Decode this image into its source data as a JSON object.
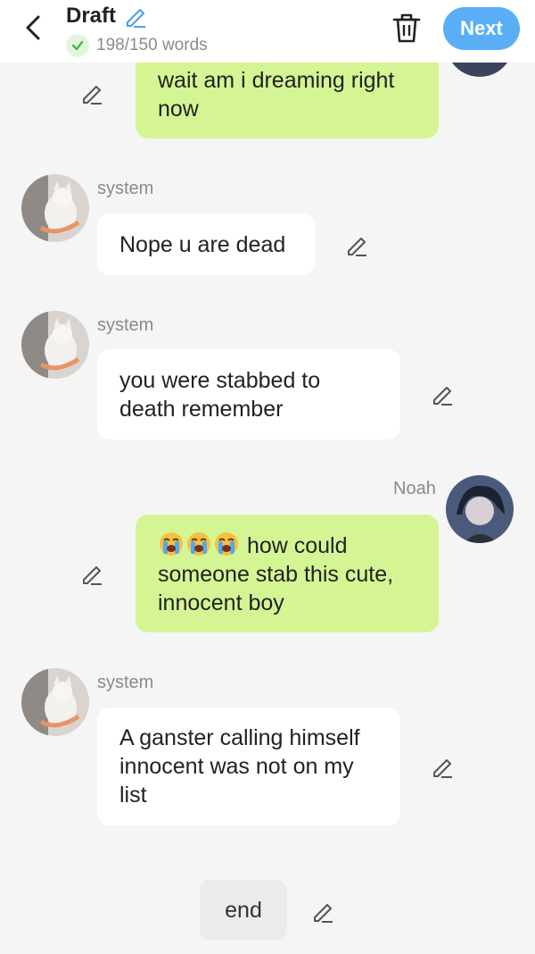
{
  "header": {
    "title": "Draft",
    "word_count": "198/150 words",
    "next_label": "Next"
  },
  "messages": [
    {
      "role": "user",
      "text": "wait am i dreaming right now"
    },
    {
      "role": "system",
      "sender": "system",
      "text": "Nope u are dead"
    },
    {
      "role": "system",
      "sender": "system",
      "text": "you were stabbed to death remember"
    },
    {
      "role": "user",
      "sender": "Noah",
      "emoji": [
        "loudly-crying-face",
        "loudly-crying-face",
        "loudly-crying-face"
      ],
      "text": " how could someone stab this cute, innocent boy"
    },
    {
      "role": "system",
      "sender": "system",
      "text": "A ganster calling himself innocent was not on my list"
    }
  ],
  "footer": {
    "end_label": "end"
  },
  "colors": {
    "user_bubble": "#d5f594",
    "system_bubble": "#ffffff",
    "accent": "#5aaef5",
    "background": "#f5f5f5"
  }
}
